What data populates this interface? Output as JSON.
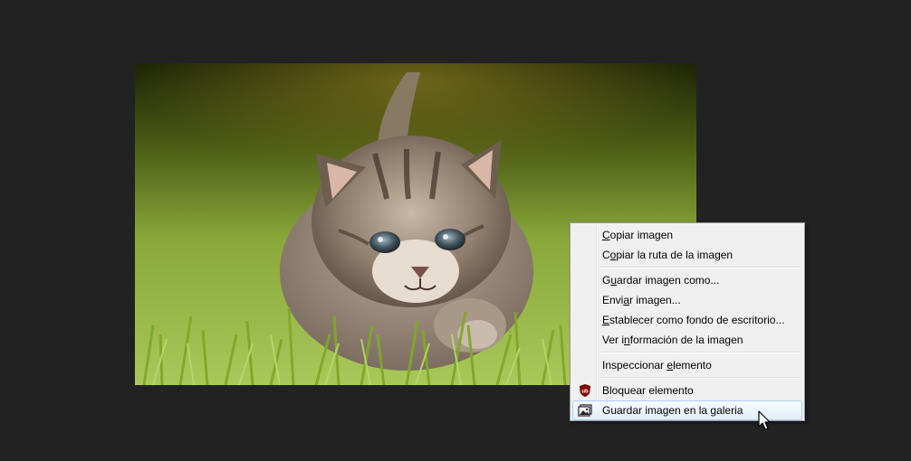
{
  "image": {
    "subject": "kitten-photo"
  },
  "context_menu": {
    "items": [
      {
        "pre": "",
        "key": "C",
        "post": "opiar imagen"
      },
      {
        "pre": "C",
        "key": "o",
        "post": "piar la ruta de la imagen"
      },
      {
        "pre": "G",
        "key": "u",
        "post": "ardar imagen como..."
      },
      {
        "pre": "Envi",
        "key": "a",
        "post": "r imagen..."
      },
      {
        "pre": "",
        "key": "E",
        "post": "stablecer como fondo de escritorio..."
      },
      {
        "pre": "Ver i",
        "key": "n",
        "post": "formación de la imagen"
      },
      {
        "pre": "Inspeccionar ",
        "key": "e",
        "post": "lemento"
      },
      {
        "pre": "Bloquear elemento",
        "key": "",
        "post": ""
      },
      {
        "pre": "Guardar imagen en la galeria",
        "key": "",
        "post": ""
      }
    ],
    "ublock_badge": "ub",
    "highlighted_item": "Guardar imagen en la galeria"
  },
  "colors": {
    "background": "#222222",
    "menu_background": "#f0f0f0",
    "highlight_border": "#aecff7",
    "ublock_red": "#800000"
  },
  "icons": {
    "block_element": "ublock-shield-icon",
    "save_to_gallery": "gallery-image-icon",
    "pointer": "mouse-cursor-icon"
  }
}
